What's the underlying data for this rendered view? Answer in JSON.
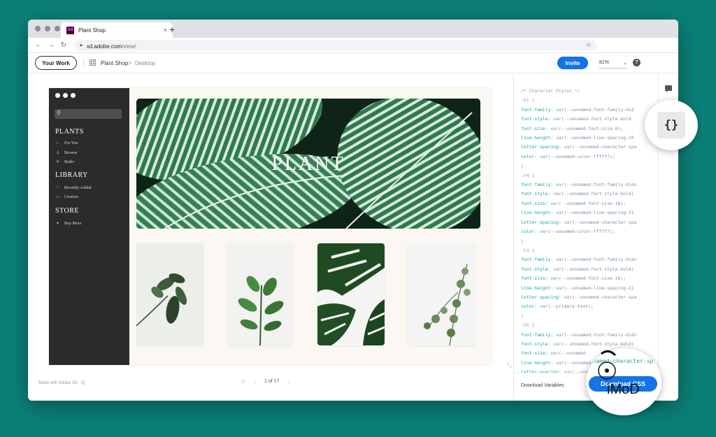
{
  "browser": {
    "tab_title": "Plant Shop",
    "tab_favicon_text": "Xd",
    "tab_close": "×",
    "new_tab": "+",
    "url_host": "xd.adobe.com",
    "url_path": "/view/"
  },
  "toolbar": {
    "your_work": "Your Work",
    "breadcrumb_project": "Plant Shop",
    "breadcrumb_separator": ">",
    "breadcrumb_page": "Desktop",
    "invite": "Invite",
    "zoom": "81%",
    "help": "?"
  },
  "artboard": {
    "hero_title": "PLANT",
    "sections": [
      {
        "heading": "PLANTS",
        "items": [
          {
            "icon": "home-icon",
            "glyph": "⌂",
            "label": "For You"
          },
          {
            "icon": "user-icon",
            "glyph": "♙",
            "label": "Browse"
          },
          {
            "icon": "radio-icon",
            "glyph": "✢",
            "label": "Radio"
          }
        ]
      },
      {
        "heading": "LIBRARY",
        "items": [
          {
            "icon": "heart-icon",
            "glyph": "♡",
            "label": "Recently Added"
          },
          {
            "icon": "chat-icon",
            "glyph": "▭",
            "label": "Creators"
          }
        ]
      },
      {
        "heading": "STORE",
        "items": [
          {
            "icon": "spark-icon",
            "glyph": "✦",
            "label": "Buy More"
          }
        ]
      }
    ]
  },
  "footer": {
    "made_with": "Made with Adobe XD",
    "page_indicator": "1 of 17"
  },
  "code_panel": {
    "lines": [
      {
        "type": "comment",
        "text": "/* Character Styles */"
      },
      {
        "type": "sel",
        "text": ".h1 {"
      },
      {
        "type": "decl",
        "prop": "font-family:",
        "val": " var(--unnamed-font-family-did"
      },
      {
        "type": "decl",
        "prop": "font-style:",
        "val": " var(--unnamed-font-style-bold"
      },
      {
        "type": "decl",
        "prop": "font-size:",
        "val": " var(--unnamed-font-size-8);"
      },
      {
        "type": "decl",
        "prop": "line-height:",
        "val": " var(--unnamed-line-spacing-10"
      },
      {
        "type": "decl",
        "prop": "letter-spacing:",
        "val": " var(--unnamed-character-spa"
      },
      {
        "type": "decl",
        "prop": "color:",
        "val": " var(--unnamed-color-ffffff);"
      },
      {
        "type": "sel",
        "text": "}"
      },
      {
        "type": "sel",
        "text": ".h4 {"
      },
      {
        "type": "decl",
        "prop": "font-family:",
        "val": " var(--unnamed-font-family-dido"
      },
      {
        "type": "decl",
        "prop": "font-style:",
        "val": " var(--unnamed-font-style-bold)"
      },
      {
        "type": "decl",
        "prop": "font-size:",
        "val": " var(--unnamed-font-size-16);"
      },
      {
        "type": "decl",
        "prop": "line-height:",
        "val": " var(--unnamed-line-spacing-21"
      },
      {
        "type": "decl",
        "prop": "letter-spacing:",
        "val": " var(--unnamed-character-spa"
      },
      {
        "type": "decl",
        "prop": "color:",
        "val": " var(--unnamed-color-ffffff);"
      },
      {
        "type": "sel",
        "text": "}"
      },
      {
        "type": "sel",
        "text": ".h3 {"
      },
      {
        "type": "decl",
        "prop": "font-family:",
        "val": " var(--unnamed-font-family-dido"
      },
      {
        "type": "decl",
        "prop": "font-style:",
        "val": " var(--unnamed-font-style-bold)"
      },
      {
        "type": "decl",
        "prop": "font-size:",
        "val": " var(--unnamed-font-size-16);"
      },
      {
        "type": "decl",
        "prop": "line-height:",
        "val": " var(--unnamed-line-spacing-21"
      },
      {
        "type": "decl",
        "prop": "letter-spacing:",
        "val": " var(--unnamed-character-spa"
      },
      {
        "type": "decl",
        "prop": "color:",
        "val": " var(--primary-text);"
      },
      {
        "type": "sel",
        "text": "}"
      },
      {
        "type": "sel",
        "text": ".h5 {"
      },
      {
        "type": "decl",
        "prop": "font-family:",
        "val": " var(--unnamed-font-family-dido"
      },
      {
        "type": "decl",
        "prop": "font-style:",
        "val": " var(--unnamed-font-style-bold)"
      },
      {
        "type": "decl",
        "prop": "font-size:",
        "val": " var(--unnamed-"
      },
      {
        "type": "decl",
        "prop": "line-height:",
        "val": " var(--unnamed-"
      },
      {
        "type": "decl",
        "prop": "letter-spacing:",
        "val": " var(--unnamed-"
      }
    ],
    "download_variables": "Download Variables",
    "bubble_code_text": "unnamed-character-sp",
    "download_css": "Download CSS"
  },
  "bubble_icon_text": "{}",
  "watermark": "iMoD",
  "colors": {
    "accent": "#1473e6",
    "background": "#0b7f77",
    "code_property": "#19a69a",
    "sidebar_dark": "#2b2b2b"
  }
}
